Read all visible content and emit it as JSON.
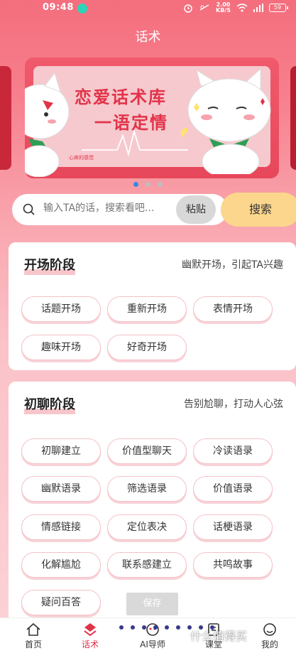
{
  "status_bar": {
    "time": "09:48",
    "speed_value": "2.00",
    "speed_unit": "KB/S",
    "battery": "59"
  },
  "page_title": "话术",
  "banner": {
    "title_line1": "恋爱话术库",
    "title_line2": "一语定情",
    "brand": "心疼的感觉"
  },
  "search": {
    "placeholder": "输入TA的话，搜索看吧...",
    "paste_label": "粘贴",
    "search_label": "搜索"
  },
  "sections": [
    {
      "title": "开场阶段",
      "desc": "幽默开场，引起TA兴趣",
      "chips": [
        "话题开场",
        "重新开场",
        "表情开场",
        "趣味开场",
        "好奇开场"
      ]
    },
    {
      "title": "初聊阶段",
      "desc": "告别尬聊，打动人心弦",
      "chips": [
        "初聊建立",
        "价值型聊天",
        "冷读语录",
        "幽默语录",
        "筛选语录",
        "价值语录",
        "情感链接",
        "定位表决",
        "话梗语录",
        "化解尴尬",
        "联系感建立",
        "共鸣故事",
        "疑问百答"
      ]
    }
  ],
  "save_label": "保存",
  "tabs": [
    {
      "label": "首页",
      "icon": "home-icon"
    },
    {
      "label": "话术",
      "icon": "chat-gem-icon"
    },
    {
      "label": "AI导师",
      "icon": "robot-icon"
    },
    {
      "label": "课堂",
      "icon": "book-icon"
    },
    {
      "label": "我的",
      "icon": "user-icon"
    }
  ],
  "watermark": "什么值得买",
  "colors": {
    "accent": "#e23349",
    "search_button": "#fcd68c",
    "active_dot": "#2f8de4"
  }
}
